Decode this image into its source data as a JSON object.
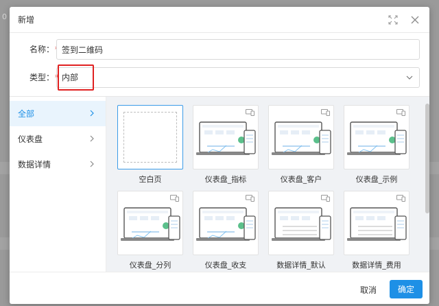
{
  "backdrop": {
    "row_number": "0"
  },
  "modal": {
    "title": "新增"
  },
  "form": {
    "name": {
      "label": "名称：",
      "required_mark": "*",
      "value": "签到二维码"
    },
    "type": {
      "label": "类型：",
      "required_mark": "*",
      "value": "内部"
    }
  },
  "sidebar": {
    "items": [
      {
        "label": "全部",
        "active": true
      },
      {
        "label": "仪表盘",
        "active": false
      },
      {
        "label": "数据详情",
        "active": false
      }
    ]
  },
  "templates": [
    {
      "label": "空白页",
      "selected": true,
      "kind": "blank"
    },
    {
      "label": "仪表盘_指标",
      "selected": false,
      "kind": "dashboard"
    },
    {
      "label": "仪表盘_客户",
      "selected": false,
      "kind": "dashboard"
    },
    {
      "label": "仪表盘_示例",
      "selected": false,
      "kind": "dashboard"
    },
    {
      "label": "仪表盘_分列",
      "selected": false,
      "kind": "dashboard"
    },
    {
      "label": "仪表盘_收支",
      "selected": false,
      "kind": "dashboard"
    },
    {
      "label": "数据详情_默认",
      "selected": false,
      "kind": "detail"
    },
    {
      "label": "数据详情_费用",
      "selected": false,
      "kind": "detail"
    }
  ],
  "footer": {
    "cancel_label": "取消",
    "ok_label": "确定"
  },
  "colors": {
    "accent": "#1e90e6",
    "active_nav_bg": "#e9f4fd",
    "highlight_box": "#e02020",
    "required": "#e0302a"
  }
}
